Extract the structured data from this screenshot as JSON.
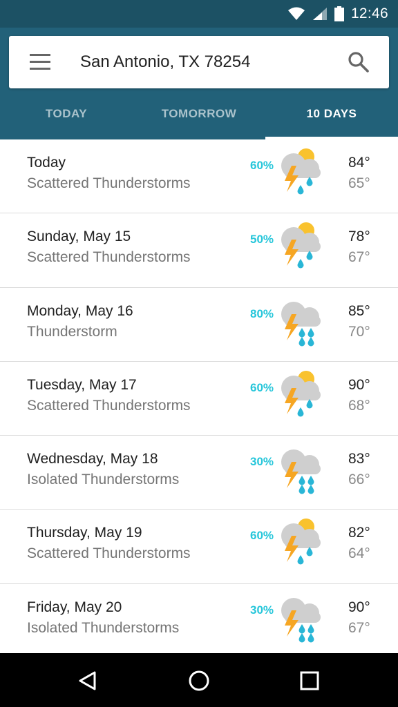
{
  "status_bar": {
    "time": "12:46",
    "icons": [
      "wifi-icon",
      "cell-signal-icon",
      "battery-icon"
    ]
  },
  "search": {
    "location": "San Antonio, TX 78254",
    "menu_icon": "menu-icon",
    "search_icon": "search-icon"
  },
  "tabs": [
    {
      "label": "TODAY",
      "active": false
    },
    {
      "label": "TOMORROW",
      "active": false
    },
    {
      "label": "10 DAYS",
      "active": true
    }
  ],
  "colors": {
    "header": "#226179",
    "status_bar": "#1c5164",
    "precip": "#26c6da",
    "bolt": "#f6a623",
    "sun": "#f9c22e",
    "cloud": "#cfcfcf",
    "drop": "#29b6d6"
  },
  "forecast": [
    {
      "day": "Today",
      "condition": "Scattered Thunderstorms",
      "precip": "60%",
      "high": "84°",
      "low": "65°",
      "icon": "scattered-thunderstorms-icon"
    },
    {
      "day": "Sunday, May 15",
      "condition": "Scattered Thunderstorms",
      "precip": "50%",
      "high": "78°",
      "low": "67°",
      "icon": "scattered-thunderstorms-icon"
    },
    {
      "day": "Monday, May 16",
      "condition": "Thunderstorm",
      "precip": "80%",
      "high": "85°",
      "low": "70°",
      "icon": "thunderstorm-icon"
    },
    {
      "day": "Tuesday, May 17",
      "condition": "Scattered Thunderstorms",
      "precip": "60%",
      "high": "90°",
      "low": "68°",
      "icon": "scattered-thunderstorms-icon"
    },
    {
      "day": "Wednesday, May 18",
      "condition": "Isolated Thunderstorms",
      "precip": "30%",
      "high": "83°",
      "low": "66°",
      "icon": "thunderstorm-icon"
    },
    {
      "day": "Thursday, May 19",
      "condition": "Scattered Thunderstorms",
      "precip": "60%",
      "high": "82°",
      "low": "64°",
      "icon": "scattered-thunderstorms-icon"
    },
    {
      "day": "Friday, May 20",
      "condition": "Isolated Thunderstorms",
      "precip": "30%",
      "high": "90°",
      "low": "67°",
      "icon": "thunderstorm-icon"
    }
  ],
  "nav": {
    "back_icon": "back-icon",
    "home_icon": "home-icon",
    "recents_icon": "recents-icon"
  }
}
